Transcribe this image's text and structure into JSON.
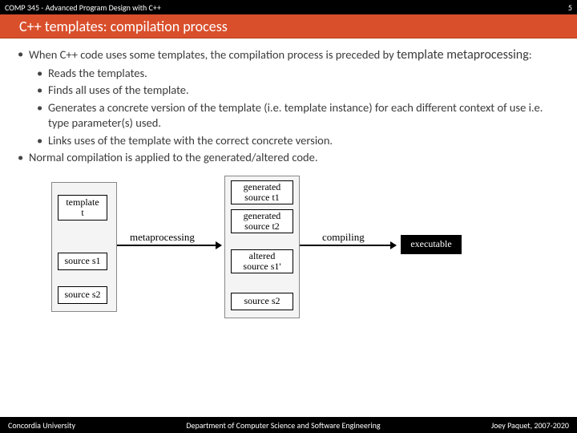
{
  "topbar": {
    "left": "COMP 345 - Advanced Program Design with C++",
    "right": "5"
  },
  "title": "C++ templates: compilation process",
  "bullets": {
    "b1_pre": "When C++ code uses some templates, the compilation process is preceded by ",
    "b1_emph": "template metaprocessing",
    "b1_post": ":",
    "b1a": "Reads the templates.",
    "b1b": "Finds all uses of the template.",
    "b1c": "Generates a concrete version of the template (i.e. template instance) for each different context of use i.e. type parameter(s) used.",
    "b1d": "Links uses of the template with the correct concrete version.",
    "b2": "Normal compilation is applied to the generated/altered code."
  },
  "diagram": {
    "template_t": "template\nt",
    "source_s1": "source s1",
    "source_s2": "source s2",
    "metaprocessing": "metaprocessing",
    "gen_t1": "generated\nsource t1",
    "gen_t2": "generated\nsource t2",
    "alt_s1": "altered\nsource s1'",
    "source_s2b": "source s2",
    "compiling": "compiling",
    "executable": "executable"
  },
  "footer": {
    "left": "Concordia University",
    "center": "Department of Computer Science and Software Engineering",
    "right": "Joey Paquet, 2007-2020"
  }
}
